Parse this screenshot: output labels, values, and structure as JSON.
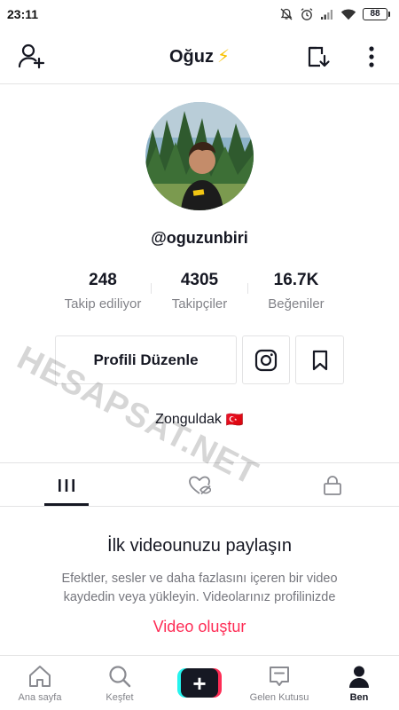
{
  "status_bar": {
    "time": "23:11",
    "battery": "88"
  },
  "header": {
    "title": "Oğuz",
    "title_emoji": "⚡"
  },
  "profile": {
    "username": "@oguzunbiri",
    "stats": [
      {
        "value": "248",
        "label": "Takip ediliyor"
      },
      {
        "value": "4305",
        "label": "Takipçiler"
      },
      {
        "value": "16.7K",
        "label": "Beğeniler"
      }
    ],
    "edit_button": "Profili Düzenle",
    "bio_location": "Zonguldak",
    "bio_flag": "🇹🇷"
  },
  "tabs": [
    {
      "icon": "grid-icon",
      "active": true
    },
    {
      "icon": "liked-hidden-icon",
      "active": false
    },
    {
      "icon": "lock-icon",
      "active": false
    }
  ],
  "empty_state": {
    "title": "İlk videounuzu paylaşın",
    "description": "Efektler, sesler ve daha fazlasını içeren bir video kaydedin veya yükleyin. Videolarınız profilinizde",
    "action": "Video oluştur"
  },
  "bottom_nav": [
    {
      "label": "Ana sayfa",
      "icon": "home-icon"
    },
    {
      "label": "Keşfet",
      "icon": "search-icon"
    },
    {
      "label": "",
      "icon": "create-plus-icon"
    },
    {
      "label": "Gelen Kutusu",
      "icon": "inbox-icon"
    },
    {
      "label": "Ben",
      "icon": "profile-icon",
      "active": true
    }
  ],
  "watermark": "HESAPSAT.NET",
  "colors": {
    "accent": "#fe2c55",
    "cyan": "#25f4ee",
    "text": "#161823",
    "bolt": "#f8c100"
  }
}
